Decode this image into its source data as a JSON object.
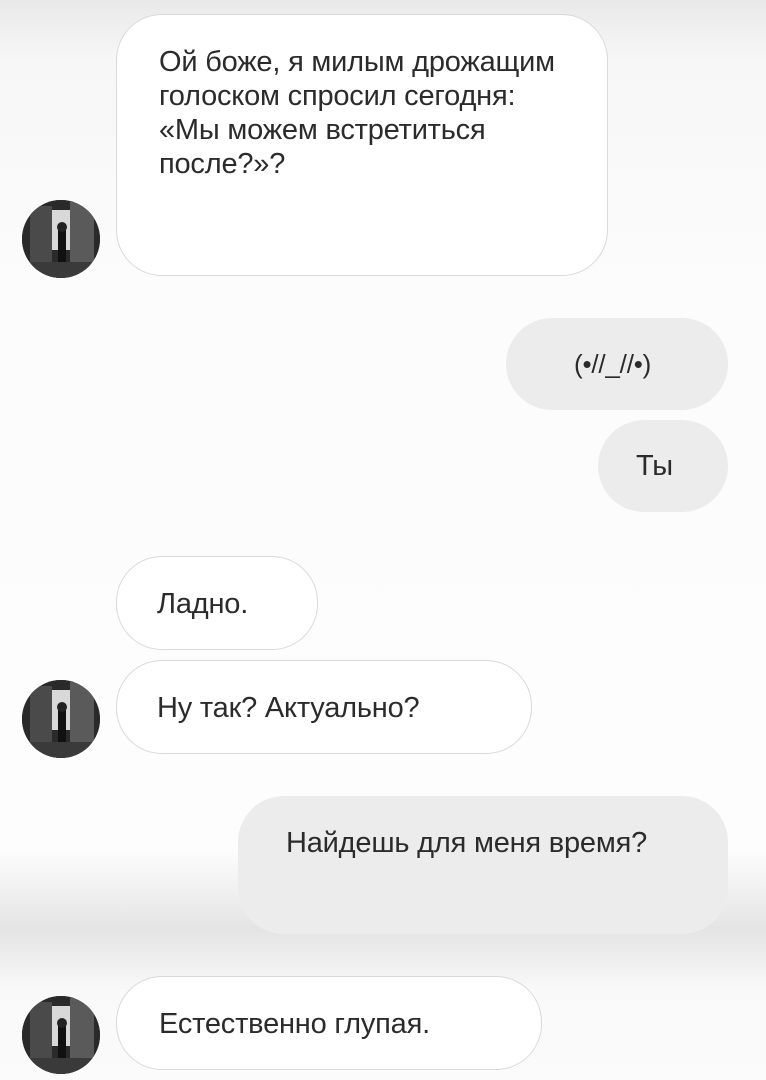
{
  "messages": [
    {
      "side": "incoming",
      "text": "Ой боже, я милым дрожащим голоском спросил сегодня: «Мы можем встретиться после?»?"
    },
    {
      "side": "outgoing",
      "text": "(•//_//•)"
    },
    {
      "side": "outgoing",
      "text": "Ты"
    },
    {
      "side": "incoming",
      "text": "Ладно."
    },
    {
      "side": "incoming",
      "text": "Ну так? Актуально?"
    },
    {
      "side": "outgoing",
      "text": "Найдешь для меня время?"
    },
    {
      "side": "incoming",
      "text": "Естественно глупая."
    }
  ],
  "icons": {
    "avatar": "contact-avatar-photo"
  },
  "colors": {
    "incoming_bubble": "#ffffff",
    "incoming_border": "#d9d9d9",
    "outgoing_bubble": "#ececec",
    "text": "#2b2b2b"
  }
}
